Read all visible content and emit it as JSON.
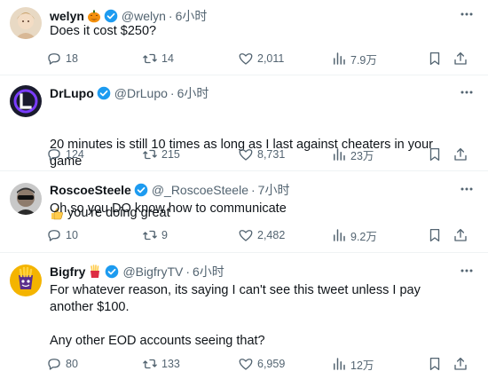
{
  "colors": {
    "text": "#0f1419",
    "secondary": "#536471",
    "verified": "#1d9bf0",
    "divider": "#eff3f4"
  },
  "icons": [
    "more-icon",
    "reply-icon",
    "retweet-icon",
    "like-icon",
    "views-icon",
    "bookmark-icon",
    "share-icon",
    "verified-badge-icon"
  ],
  "tweets": [
    {
      "name": "welyn",
      "handle": "@welyn",
      "dot": "·",
      "time": "6小时",
      "text": "Does it cost $250?",
      "replies": "18",
      "retweets": "14",
      "likes": "2,011",
      "views": "7.9万",
      "name_emoji": "jack-o-lantern-icon"
    },
    {
      "name": "DrLupo",
      "handle": "@DrLupo",
      "dot": "·",
      "time": "6小时",
      "text": "20 minutes is still 10 times as long as I last against cheaters in your game",
      "text2": "you're doing great",
      "text2_emoji": "thumbs-up-icon",
      "replies": "124",
      "retweets": "215",
      "likes": "8,731",
      "views": "23万"
    },
    {
      "name": "RoscoeSteele",
      "handle": "@_RoscoeSteele",
      "dot": "·",
      "time": "7小时",
      "text": "Oh so you DO know how to communicate",
      "replies": "10",
      "retweets": "9",
      "likes": "2,482",
      "views": "9.2万"
    },
    {
      "name": "Bigfry",
      "handle": "@BigfryTV",
      "dot": "·",
      "time": "6小时",
      "text": "For whatever reason, its saying I can't see this tweet unless I pay another $100.\n\nAny other EOD accounts seeing that?",
      "replies": "80",
      "retweets": "133",
      "likes": "6,959",
      "views": "12万",
      "name_emoji": "fries-icon"
    }
  ]
}
